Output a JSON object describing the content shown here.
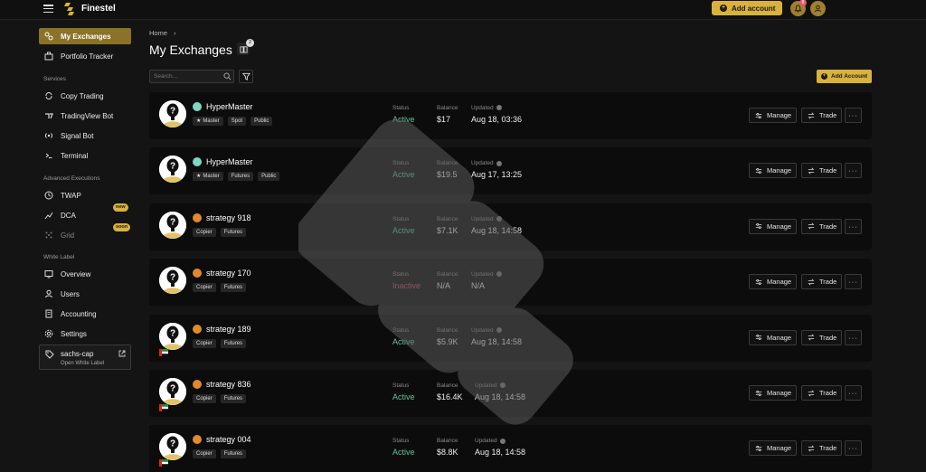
{
  "app": {
    "brand": "Finestel",
    "add_account_label": "Add account",
    "notification_count": "8"
  },
  "sidebar": {
    "items_top": [
      {
        "label": "My Exchanges",
        "icon": "exchanges-icon",
        "active": true
      },
      {
        "label": "Portfolio Tracker",
        "icon": "portfolio-icon"
      }
    ],
    "services_header": "Services",
    "services": [
      {
        "label": "Copy Trading",
        "icon": "copy-trading-icon"
      },
      {
        "label": "TradingView Bot",
        "icon": "tradingview-icon"
      },
      {
        "label": "Signal Bot",
        "icon": "signal-icon"
      },
      {
        "label": "Terminal",
        "icon": "terminal-icon"
      }
    ],
    "advanced_header": "Advanced Executions",
    "advanced": [
      {
        "label": "TWAP",
        "icon": "clock-icon"
      },
      {
        "label": "DCA",
        "icon": "dca-icon",
        "badge": "new"
      },
      {
        "label": "Grid",
        "icon": "grid-icon",
        "badge": "soon",
        "disabled": true
      }
    ],
    "whitelabel_header": "White Label",
    "whitelabel": [
      {
        "label": "Overview",
        "icon": "overview-icon"
      },
      {
        "label": "Users",
        "icon": "users-icon"
      },
      {
        "label": "Accounting",
        "icon": "accounting-icon"
      },
      {
        "label": "Settings",
        "icon": "settings-icon"
      }
    ],
    "org": {
      "name": "sachs-cap",
      "sub": "Open White Label"
    }
  },
  "main": {
    "breadcrumb": "Home",
    "title": "My Exchanges",
    "book_badge": "2",
    "search_placeholder": "Search...",
    "add_account_label": "Add Account",
    "col_status": "Status",
    "col_balance": "Balance",
    "col_updated": "Updated",
    "manage_label": "Manage",
    "trade_label": "Trade",
    "more_label": "···",
    "accounts": [
      {
        "name": "HyperMaster",
        "exchange_icon": "hyperliquid",
        "tags": [
          "Master",
          "Spot",
          "Public"
        ],
        "status": "Active",
        "balance": "$17",
        "updated": "Aug 18, 03:36"
      },
      {
        "name": "HyperMaster",
        "exchange_icon": "hyperliquid",
        "tags": [
          "Master",
          "Futures",
          "Public"
        ],
        "status": "Active",
        "balance": "$19.5",
        "updated": "Aug 17, 13:25"
      },
      {
        "name": "strategy 918",
        "exchange_icon": "orange",
        "tags": [
          "Copier",
          "Futures"
        ],
        "status": "Active",
        "balance": "$7.1K",
        "updated": "Aug 18, 14:58"
      },
      {
        "name": "strategy 170",
        "exchange_icon": "orange",
        "tags": [
          "Copier",
          "Futures"
        ],
        "status": "Inactive",
        "balance": "N/A",
        "updated": "N/A"
      },
      {
        "name": "strategy 189",
        "exchange_icon": "orange",
        "tags": [
          "Copier",
          "Futures"
        ],
        "status": "Active",
        "balance": "$5.9K",
        "updated": "Aug 18, 14:58"
      },
      {
        "name": "strategy 836",
        "exchange_icon": "orange",
        "tags": [
          "Copier",
          "Futures"
        ],
        "status": "Active",
        "balance": "$16.4K",
        "updated": "Aug 18, 14:58"
      },
      {
        "name": "strategy 004",
        "exchange_icon": "orange",
        "tags": [
          "Copier",
          "Futures"
        ],
        "status": "Active",
        "balance": "$8.8K",
        "updated": "Aug 18, 14:58"
      }
    ]
  },
  "colors": {
    "accent": "#d9b23c",
    "active": "#62c59a",
    "inactive": "#d64b63"
  }
}
